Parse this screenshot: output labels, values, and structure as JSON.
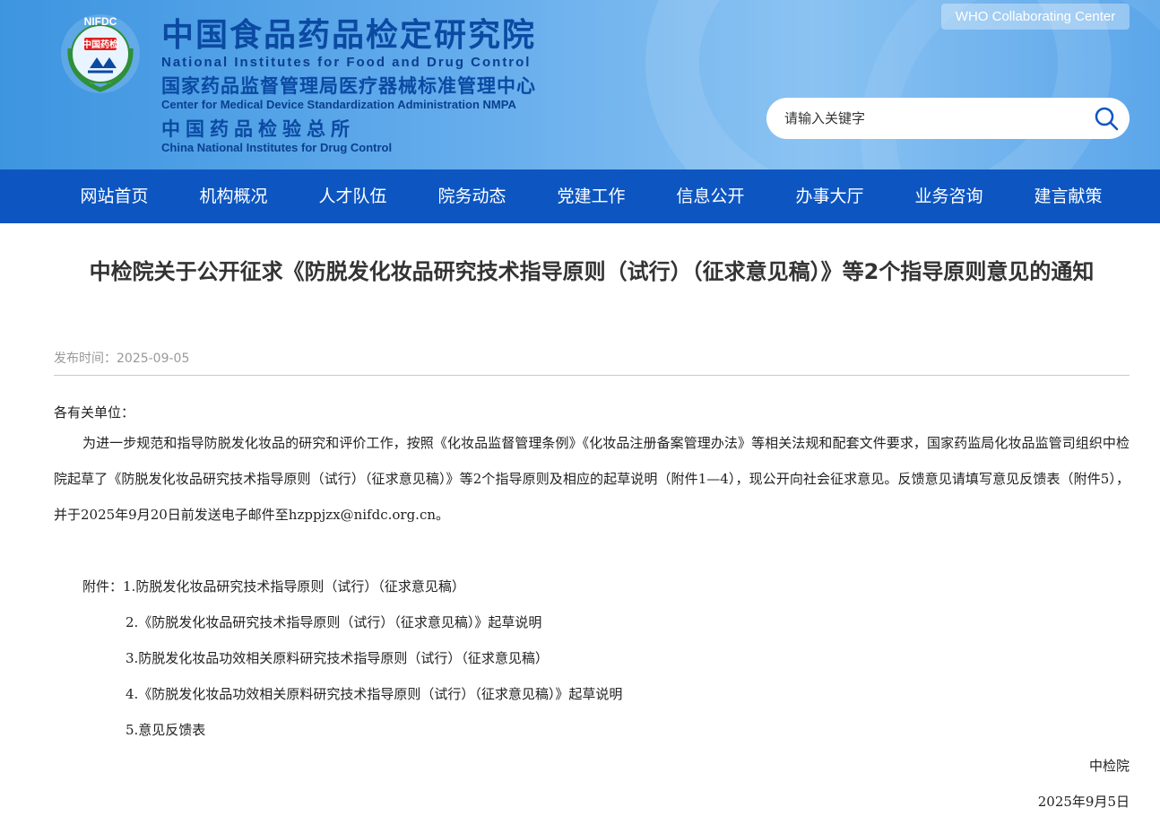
{
  "header": {
    "logo_text": "NIFDC",
    "logo_badge": "中国药检",
    "title_cn": "中国食品药品检定研究院",
    "title_en": "National Institutes for Food and Drug Control",
    "subtitle_cn": "国家药品监督管理局医疗器械标准管理中心",
    "subtitle_en": "Center for Medical Device Standardization Administration NMPA",
    "subtitle2_cn": "中国药品检验总所",
    "subtitle2_en": "China National Institutes for Drug Control",
    "who_label": "WHO Collaborating Center",
    "search_placeholder": "请输入关键字"
  },
  "nav": {
    "items": [
      "网站首页",
      "机构概况",
      "人才队伍",
      "院务动态",
      "党建工作",
      "信息公开",
      "办事大厅",
      "业务咨询",
      "建言献策"
    ]
  },
  "article": {
    "title": "中检院关于公开征求《防脱发化妆品研究技术指导原则（试行）（征求意见稿）》等2个指导原则意见的通知",
    "publish_label": "发布时间：",
    "publish_date": "2025-09-05",
    "greeting": "各有关单位：",
    "body": "为进一步规范和指导防脱发化妆品的研究和评价工作，按照《化妆品监督管理条例》《化妆品注册备案管理办法》等相关法规和配套文件要求，国家药监局化妆品监管司组织中检院起草了《防脱发化妆品研究技术指导原则（试行）（征求意见稿）》等2个指导原则及相应的起草说明（附件1—4），现公开向社会征求意见。反馈意见请填写意见反馈表（附件5），并于2025年9月20日前发送电子邮件至hzppjzx@nifdc.org.cn。",
    "attachments_label": "附件：",
    "attachments": [
      "1.防脱发化妆品研究技术指导原则（试行）（征求意见稿）",
      "2.《防脱发化妆品研究技术指导原则（试行）（征求意见稿）》起草说明",
      "3.防脱发化妆品功效相关原料研究技术指导原则（试行）（征求意见稿）",
      "4.《防脱发化妆品功效相关原料研究技术指导原则（试行）（征求意见稿）》起草说明",
      "5.意见反馈表"
    ],
    "signer": "中检院",
    "sign_date": "2025年9月5日"
  },
  "colors": {
    "nav_bg": "#0d56c2",
    "header_title": "#0b4aa2"
  },
  "icons": {
    "search": "search-icon",
    "logo": "nifdc-logo-icon"
  }
}
